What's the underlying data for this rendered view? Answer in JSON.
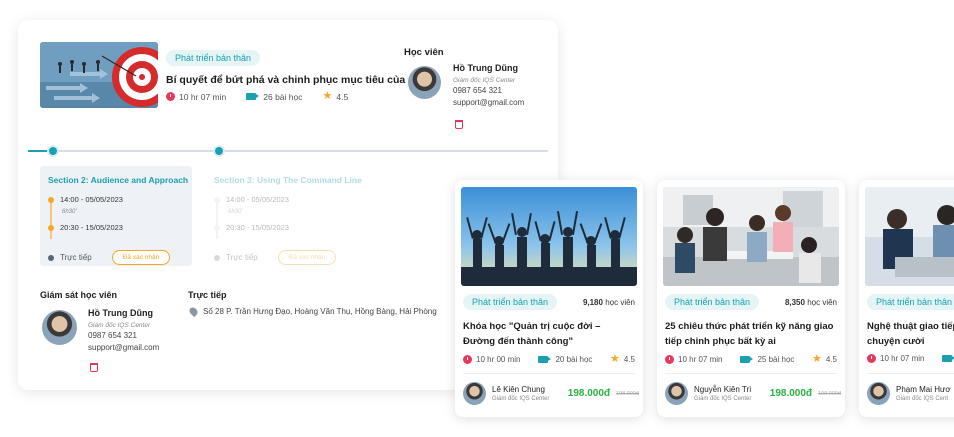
{
  "course": {
    "tag": "Phát triển bản thân",
    "title": "Bí quyết để bứt phá và chinh phục mục tiêu của mình",
    "duration": "10 hr 07 min",
    "lessons": "26 bài học",
    "rating": "4.5"
  },
  "student": {
    "heading": "Học viên",
    "name": "Hồ Trung Dũng",
    "role": "Giám đốc IQS Center",
    "phone": "0987 654 321",
    "email": "support@gmail.com"
  },
  "sections": [
    {
      "title": "Section 2: Audience and Approach",
      "session1_time": "14:00 - 05/05/2023",
      "session1_note": "6h30'",
      "session2_time": "20:30 - 15/05/2023",
      "status": "Trực tiếp",
      "badge": "Đã xác nhận"
    },
    {
      "title": "Section 3: Using The Command Line",
      "session1_time": "14:00 - 05/05/2023",
      "session1_note": "6h30'",
      "session2_time": "20:30 - 15/05/2023",
      "status": "Trực tiếp",
      "badge": "Đã xác nhận"
    }
  ],
  "supervisor": {
    "heading": "Giám sát học viên",
    "name": "Hồ Trung Dũng",
    "role": "Giám đốc IQS Center",
    "phone": "0987 654 321",
    "email": "support@gmail.com"
  },
  "live": {
    "heading": "Trực tiếp",
    "address": "Số 28 P. Trần Hưng Đạo, Hoàng Văn Thụ, Hồng Bàng, Hải Phòng"
  },
  "cards": [
    {
      "tag": "Phát triển bản thân",
      "count": "9,180",
      "count_suffix": "học viên",
      "title": "Khóa học \"Quản trị cuộc đời – Đường đến thành công\"",
      "duration": "10 hr 00 min",
      "lessons": "20 bài học",
      "rating": "4.5",
      "teacher": "Lê Kiên Chung",
      "teacher_role": "Giám đốc IQS Center",
      "price": "198.000đ",
      "old_price": "198.000đ"
    },
    {
      "tag": "Phát triển bản thân",
      "count": "8,350",
      "count_suffix": "học viên",
      "title": "25 chiêu thức phát triển kỹ năng giao tiếp chinh phục bất kỳ ai",
      "duration": "10 hr 07 min",
      "lessons": "25 bài học",
      "rating": "4.5",
      "teacher": "Nguyễn Kiên Trì",
      "teacher_role": "Giám đốc IQS Center",
      "price": "198.000đ",
      "old_price": "198.000đ"
    },
    {
      "tag": "Phát triển bản thân",
      "title": "Nghệ thuật giao tiếp chuyện cười",
      "duration": "10 hr 07 min",
      "teacher": "Phạm Mai Hươ",
      "teacher_role": "Giám đốc IQS Cent"
    }
  ],
  "colors": {
    "accent": "#1aa0b0",
    "danger": "#e8375a",
    "warning": "#f5a623",
    "price": "#2ab043"
  }
}
